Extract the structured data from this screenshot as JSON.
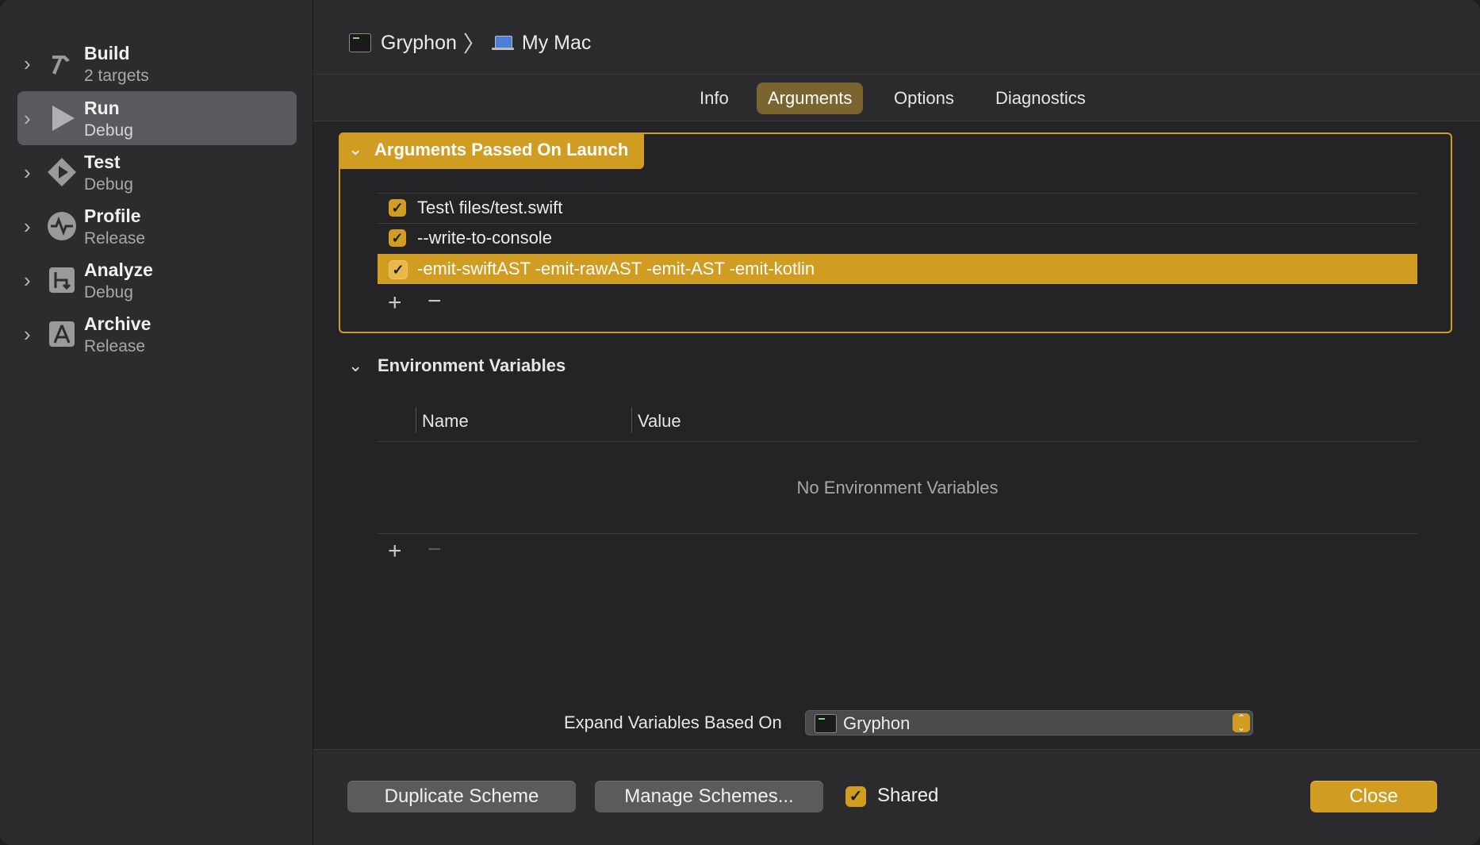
{
  "sidebar": {
    "items": [
      {
        "title": "Build",
        "subtitle": "2 targets",
        "icon": "hammer-icon"
      },
      {
        "title": "Run",
        "subtitle": "Debug",
        "icon": "play-icon"
      },
      {
        "title": "Test",
        "subtitle": "Debug",
        "icon": "test-diamond-icon"
      },
      {
        "title": "Profile",
        "subtitle": "Release",
        "icon": "waveform-icon"
      },
      {
        "title": "Analyze",
        "subtitle": "Debug",
        "icon": "analyze-icon"
      },
      {
        "title": "Archive",
        "subtitle": "Release",
        "icon": "archive-icon"
      }
    ],
    "selected": "Run"
  },
  "header": {
    "scheme": "Gryphon",
    "destination": "My Mac"
  },
  "tabs": [
    {
      "label": "Info"
    },
    {
      "label": "Arguments"
    },
    {
      "label": "Options"
    },
    {
      "label": "Diagnostics"
    }
  ],
  "active_tab": "Arguments",
  "arguments": {
    "title": "Arguments Passed On Launch",
    "items": [
      {
        "checked": true,
        "text": "Test\\ files/test.swift"
      },
      {
        "checked": true,
        "text": "--write-to-console"
      },
      {
        "checked": true,
        "text": "-emit-swiftAST -emit-rawAST -emit-AST -emit-kotlin"
      }
    ],
    "selected_index": 2
  },
  "environment": {
    "title": "Environment Variables",
    "columns": [
      "Name",
      "Value"
    ],
    "empty_message": "No Environment Variables"
  },
  "expand": {
    "label": "Expand Variables Based On",
    "value": "Gryphon"
  },
  "footer": {
    "duplicate_label": "Duplicate Scheme",
    "manage_label": "Manage Schemes...",
    "shared_label": "Shared",
    "shared_checked": true,
    "close_label": "Close"
  },
  "colors": {
    "accent": "#d19c22",
    "sidebar_selected": "#5a5a5e",
    "background": "#242426"
  }
}
